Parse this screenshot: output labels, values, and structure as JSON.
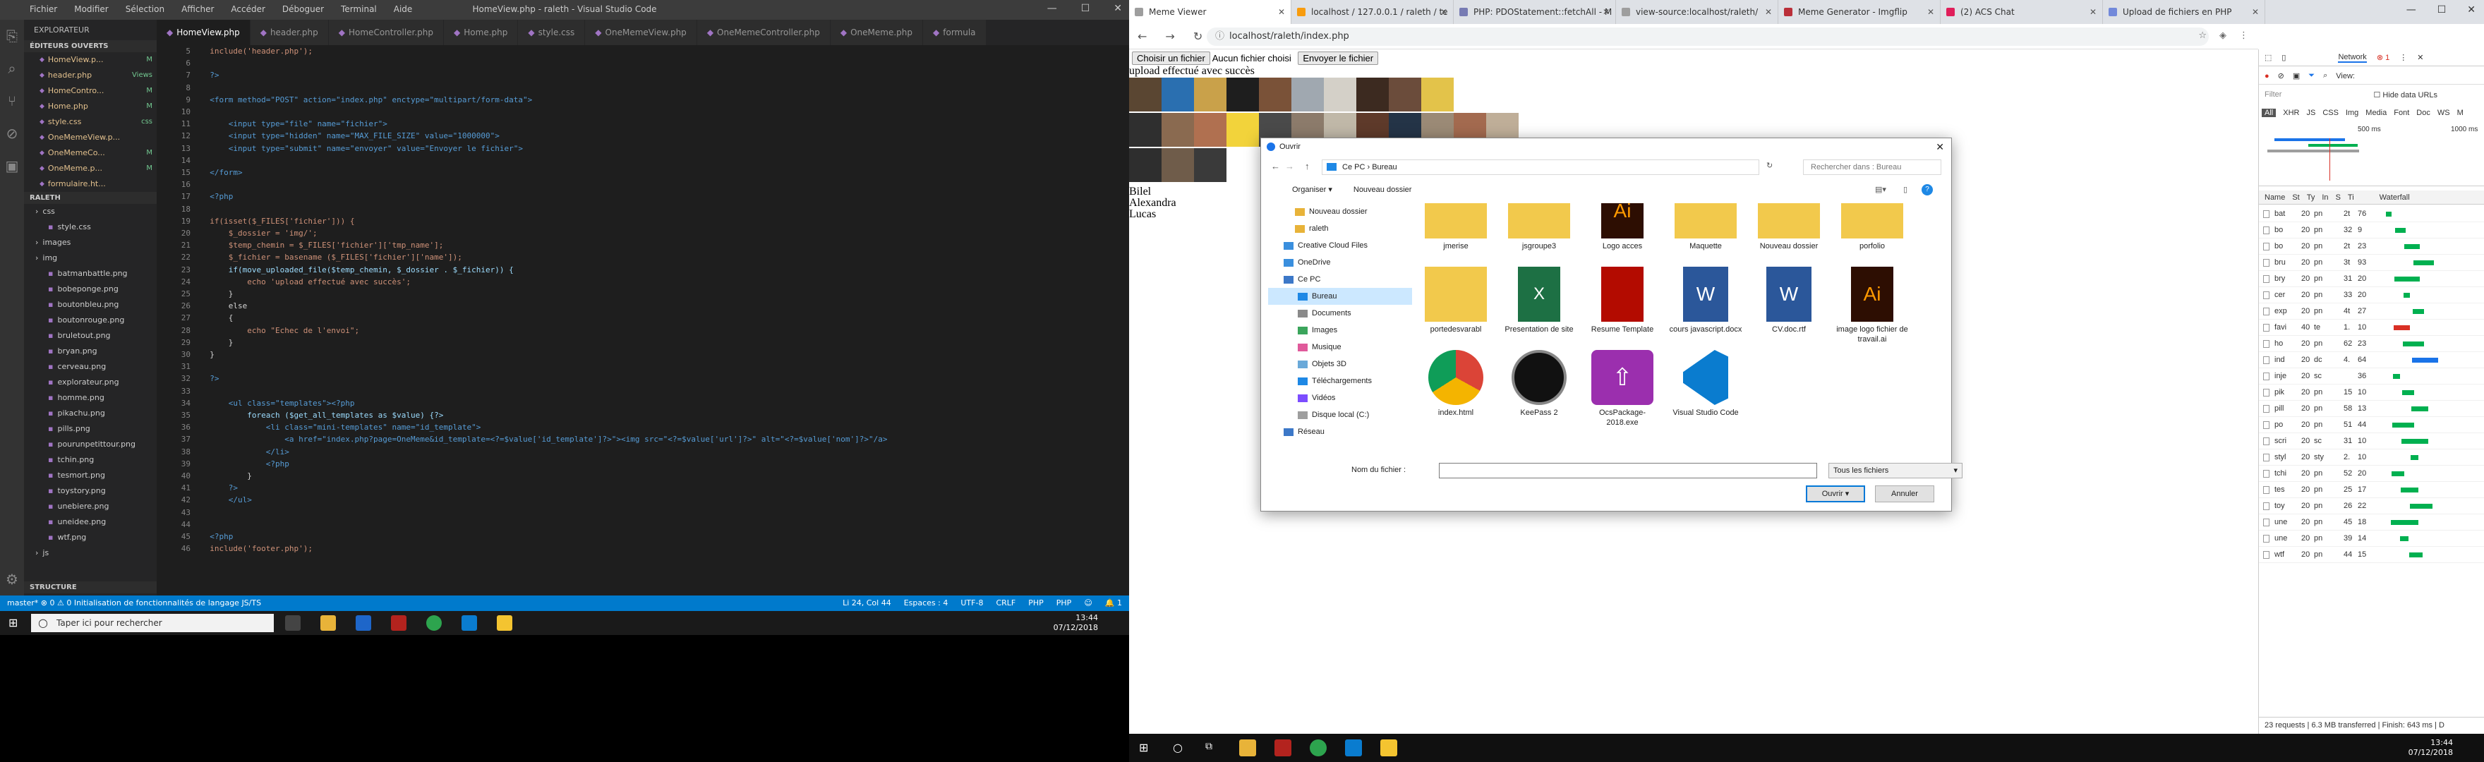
{
  "vscode": {
    "title": "HomeView.php - raleth - Visual Studio Code",
    "menu": [
      "Fichier",
      "Modifier",
      "Sélection",
      "Afficher",
      "Accéder",
      "Déboguer",
      "Terminal",
      "Aide"
    ],
    "explorer_label": "EXPLORATEUR",
    "open_editors_label": "ÉDITEURS OUVERTS",
    "open_editors": [
      {
        "name": "HomeView.p...",
        "mark": "M"
      },
      {
        "name": "header.php",
        "mark": "Views"
      },
      {
        "name": "HomeContro...",
        "mark": "M"
      },
      {
        "name": "Home.php",
        "mark": "M"
      },
      {
        "name": "style.css",
        "mark": "css"
      },
      {
        "name": "OneMemeView.p...",
        "mark": ""
      },
      {
        "name": "OneMemeCo...",
        "mark": "M"
      },
      {
        "name": "OneMeme.p...",
        "mark": "M"
      },
      {
        "name": "formulaire.ht...",
        "mark": ""
      }
    ],
    "project_label": "RALETH",
    "tree": [
      "css",
      "style.css",
      "images",
      "img",
      "batmanbattle.png",
      "bobeponge.png",
      "boutonbleu.png",
      "boutonrouge.png",
      "bruletout.png",
      "bryan.png",
      "cerveau.png",
      "explorateur.png",
      "homme.png",
      "pikachu.png",
      "pills.png",
      "pourunpetittour.png",
      "tchin.png",
      "tesmort.png",
      "toystory.png",
      "unebiere.png",
      "uneidee.png",
      "wtf.png",
      "js"
    ],
    "structure_label": "STRUCTURE",
    "tabs": [
      "HomeView.php",
      "header.php",
      "HomeController.php",
      "Home.php",
      "style.css",
      "OneMemeView.php",
      "OneMemeController.php",
      "OneMeme.php",
      "formula"
    ],
    "code_lines": [
      {
        "n": "5",
        "t": "  include('header.php');"
      },
      {
        "n": "6",
        "t": ""
      },
      {
        "n": "7",
        "t": "  ?>"
      },
      {
        "n": "8",
        "t": ""
      },
      {
        "n": "9",
        "t": "  <form method=\"POST\" action=\"index.php\" enctype=\"multipart/form-data\">"
      },
      {
        "n": "10",
        "t": ""
      },
      {
        "n": "11",
        "t": "      <input type=\"file\" name=\"fichier\">"
      },
      {
        "n": "12",
        "t": "      <input type=\"hidden\" name=\"MAX_FILE_SIZE\" value=\"1000000\">"
      },
      {
        "n": "13",
        "t": "      <input type=\"submit\" name=\"envoyer\" value=\"Envoyer le fichier\">"
      },
      {
        "n": "14",
        "t": ""
      },
      {
        "n": "15",
        "t": "  </form>"
      },
      {
        "n": "16",
        "t": ""
      },
      {
        "n": "17",
        "t": "  <?php"
      },
      {
        "n": "18",
        "t": ""
      },
      {
        "n": "19",
        "t": "  if(isset($_FILES['fichier'])) {"
      },
      {
        "n": "20",
        "t": "      $_dossier = 'img/';"
      },
      {
        "n": "21",
        "t": "      $temp_chemin = $_FILES['fichier']['tmp_name'];"
      },
      {
        "n": "22",
        "t": "      $_fichier = basename ($_FILES['fichier']['name']);"
      },
      {
        "n": "23",
        "t": "      if(move_uploaded_file($temp_chemin, $_dossier . $_fichier)) {"
      },
      {
        "n": "24",
        "t": "          echo 'upload effectué avec succès';"
      },
      {
        "n": "25",
        "t": "      }"
      },
      {
        "n": "26",
        "t": "      else"
      },
      {
        "n": "27",
        "t": "      {"
      },
      {
        "n": "28",
        "t": "          echo \"Echec de l'envoi\";"
      },
      {
        "n": "29",
        "t": "      }"
      },
      {
        "n": "30",
        "t": "  }"
      },
      {
        "n": "31",
        "t": ""
      },
      {
        "n": "32",
        "t": "  ?>"
      },
      {
        "n": "33",
        "t": ""
      },
      {
        "n": "34",
        "t": "      <ul class=\"templates\"><?php"
      },
      {
        "n": "35",
        "t": "          foreach ($get_all_templates as $value) {?>"
      },
      {
        "n": "36",
        "t": "              <li class=\"mini-templates\" name=\"id_template\">"
      },
      {
        "n": "37",
        "t": "                  <a href=\"index.php?page=OneMeme&id_template=<?=$value['id_template']?>\"><img src=\"<?=$value['url']?>\" alt=\"<?=$value['nom']?>\"/a>"
      },
      {
        "n": "38",
        "t": "              </li>"
      },
      {
        "n": "39",
        "t": "              <?php"
      },
      {
        "n": "40",
        "t": "          }"
      },
      {
        "n": "41",
        "t": "      ?>"
      },
      {
        "n": "42",
        "t": "      </ul>"
      },
      {
        "n": "43",
        "t": ""
      },
      {
        "n": "44",
        "t": ""
      },
      {
        "n": "45",
        "t": "  <?php"
      },
      {
        "n": "46",
        "t": "  include('footer.php');"
      }
    ],
    "status_left": "master*  ⊗ 0 ⚠ 0  Initialisation de fonctionnalités de langage JS/TS",
    "status_right": [
      "Li 24, Col 44",
      "Espaces : 4",
      "UTF-8",
      "CRLF",
      "PHP",
      "PHP",
      "☺",
      "🔔 1"
    ],
    "search_placeholder": "Taper ici pour rechercher",
    "clock_time": "13:44",
    "clock_date": "07/12/2018"
  },
  "browser": {
    "tabs": [
      {
        "label": "Meme Viewer",
        "color": "#9e9e9e"
      },
      {
        "label": "localhost / 127.0.0.1 / raleth / te",
        "color": "#f89c0e"
      },
      {
        "label": "PHP: PDOStatement::fetchAll - M",
        "color": "#777bb3"
      },
      {
        "label": "view-source:localhost/raleth/",
        "color": "#9e9e9e"
      },
      {
        "label": "Meme Generator - Imgflip",
        "color": "#ba2f39"
      },
      {
        "label": "(2) ACS Chat",
        "color": "#e01e5a"
      },
      {
        "label": "Upload de fichiers en PHP",
        "color": "#7289da"
      }
    ],
    "url": "localhost/raleth/index.php",
    "choose_btn": "Choisir un fichier",
    "no_file": "Aucun fichier choisi",
    "send_btn": "Envoyer le fichier",
    "upload_msg": "upload effectué avec succès",
    "names": [
      "Bilel",
      "Alexandra",
      "Lucas"
    ],
    "thumb_colors": [
      "#5a4632",
      "#2a6fb0",
      "#c9a14a",
      "#1e1e1e",
      "#7a5238",
      "#a0a8b0",
      "#d4d0c8",
      "#3c2a20",
      "#6b4c3b",
      "#e3c34a",
      "#2f2f2f",
      "#8a6a50",
      "#b07050",
      "#f2d33b",
      "#4a4a4a",
      "#8c7b6b",
      "#c0b8a8",
      "#5e3a2a",
      "#243447",
      "#9b8a76",
      "#a36a4f",
      "#bfae98",
      "#2e2e2e",
      "#6f5c4a",
      "#3a3a3a"
    ],
    "time": "13:44",
    "date": "07/12/2018"
  },
  "dialog": {
    "title": "Ouvrir",
    "path": [
      "Ce PC",
      "Bureau"
    ],
    "search_placeholder": "Rechercher dans : Bureau",
    "organize": "Organiser ▾",
    "new_folder": "Nouveau dossier",
    "tree": [
      {
        "label": "Nouveau dossier",
        "kind": "folder",
        "sel": false
      },
      {
        "label": "raleth",
        "kind": "folder",
        "sel": false
      },
      {
        "label": "Creative Cloud Files",
        "kind": "cloud",
        "sel": false
      },
      {
        "label": "OneDrive",
        "kind": "cloud",
        "sel": false
      },
      {
        "label": "Ce PC",
        "kind": "pc",
        "sel": false
      },
      {
        "label": "Bureau",
        "kind": "desk",
        "sel": true
      },
      {
        "label": "Documents",
        "kind": "doc",
        "sel": false
      },
      {
        "label": "Images",
        "kind": "img",
        "sel": false
      },
      {
        "label": "Musique",
        "kind": "music",
        "sel": false
      },
      {
        "label": "Objets 3D",
        "kind": "obj",
        "sel": false
      },
      {
        "label": "Téléchargements",
        "kind": "dl",
        "sel": false
      },
      {
        "label": "Vidéos",
        "kind": "vid",
        "sel": false
      },
      {
        "label": "Disque local (C:)",
        "kind": "disk",
        "sel": false
      },
      {
        "label": "Réseau",
        "kind": "net",
        "sel": false
      }
    ],
    "files": [
      {
        "name": "jmerise",
        "type": "folder"
      },
      {
        "name": "jsgroupe3",
        "type": "folder"
      },
      {
        "name": "Logo acces",
        "type": "ai"
      },
      {
        "name": "Maquette",
        "type": "folder"
      },
      {
        "name": "Nouveau dossier",
        "type": "folder"
      },
      {
        "name": "porfolio",
        "type": "folder"
      },
      {
        "name": "portedesvarabl",
        "type": "folder"
      },
      {
        "name": "Presentation de site",
        "type": "xls"
      },
      {
        "name": "Resume Template",
        "type": "pdf"
      },
      {
        "name": "cours javascript.docx",
        "type": "docx"
      },
      {
        "name": "CV.doc.rtf",
        "type": "docx"
      },
      {
        "name": "image logo fichier de travail.ai",
        "type": "ai"
      },
      {
        "name": "index.html",
        "type": "chrome"
      },
      {
        "name": "KeePass 2",
        "type": "keepass"
      },
      {
        "name": "OcsPackage-2018.exe",
        "type": "ocs"
      },
      {
        "name": "Visual Studio Code",
        "type": "vscode"
      }
    ],
    "filename_label": "Nom du fichier :",
    "filter": "Tous les fichiers",
    "open_btn": "Ouvrir",
    "cancel_btn": "Annuler"
  },
  "devtools": {
    "tab": "Network",
    "view_label": "View:",
    "filter_placeholder": "Filter",
    "hide_urls": "Hide data URLs",
    "types": [
      "All",
      "XHR",
      "JS",
      "CSS",
      "Img",
      "Media",
      "Font",
      "Doc",
      "WS",
      "M"
    ],
    "ticks": [
      "500 ms",
      "1000 ms"
    ],
    "cols": [
      "Name",
      "St",
      "Ty",
      "In",
      "S",
      "Ti",
      "Waterfall"
    ],
    "requests": [
      {
        "n": "bat",
        "s": "20",
        "t": "pn",
        "i": "in",
        "z": "2t",
        "m": "76"
      },
      {
        "n": "bo",
        "s": "20",
        "t": "pn",
        "i": "in",
        "z": "32",
        "m": "9"
      },
      {
        "n": "bo",
        "s": "20",
        "t": "pn",
        "i": "in",
        "z": "2t",
        "m": "23"
      },
      {
        "n": "bru",
        "s": "20",
        "t": "pn",
        "i": "in",
        "z": "3t",
        "m": "93"
      },
      {
        "n": "bry",
        "s": "20",
        "t": "pn",
        "i": "in",
        "z": "31",
        "m": "20"
      },
      {
        "n": "cer",
        "s": "20",
        "t": "pn",
        "i": "in",
        "z": "33",
        "m": "20"
      },
      {
        "n": "exp",
        "s": "20",
        "t": "pn",
        "i": "in",
        "z": "4t",
        "m": "27"
      },
      {
        "n": "favi",
        "s": "40",
        "t": "te",
        "i": "ot",
        "z": "1.",
        "m": "10"
      },
      {
        "n": "ho",
        "s": "20",
        "t": "pn",
        "i": "in",
        "z": "62",
        "m": "23"
      },
      {
        "n": "ind",
        "s": "20",
        "t": "dc",
        "i": "ot",
        "z": "4.",
        "m": "64"
      },
      {
        "n": "inje",
        "s": "20",
        "t": "sc",
        "i": "in",
        "z": "",
        "m": "36"
      },
      {
        "n": "pik",
        "s": "20",
        "t": "pn",
        "i": "in",
        "z": "15",
        "m": "10"
      },
      {
        "n": "pill",
        "s": "20",
        "t": "pn",
        "i": "in",
        "z": "58",
        "m": "13"
      },
      {
        "n": "po",
        "s": "20",
        "t": "pn",
        "i": "in",
        "z": "51",
        "m": "44"
      },
      {
        "n": "scri",
        "s": "20",
        "t": "sc",
        "i": "in",
        "z": "31",
        "m": "10"
      },
      {
        "n": "styl",
        "s": "20",
        "t": "sty",
        "i": "in",
        "z": "2.",
        "m": "10"
      },
      {
        "n": "tchi",
        "s": "20",
        "t": "pn",
        "i": "in",
        "z": "52",
        "m": "20"
      },
      {
        "n": "tes",
        "s": "20",
        "t": "pn",
        "i": "in",
        "z": "25",
        "m": "17"
      },
      {
        "n": "toy",
        "s": "20",
        "t": "pn",
        "i": "in",
        "z": "26",
        "m": "22"
      },
      {
        "n": "une",
        "s": "20",
        "t": "pn",
        "i": "in",
        "z": "45",
        "m": "18"
      },
      {
        "n": "une",
        "s": "20",
        "t": "pn",
        "i": "in",
        "z": "39",
        "m": "14"
      },
      {
        "n": "wtf",
        "s": "20",
        "t": "pn",
        "i": "in",
        "z": "44",
        "m": "15"
      }
    ],
    "footer": "23 requests | 6.3 MB transferred | Finish: 643 ms | D"
  }
}
